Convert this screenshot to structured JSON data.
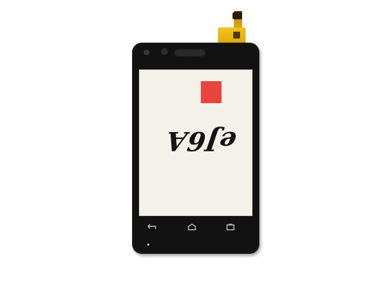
{
  "image": {
    "subject": "touchscreen-digitizer-panel",
    "handwritten_marking": "eJ6A",
    "icons": {
      "back": "back-arrow-icon",
      "home": "home-icon",
      "menu": "menu-icon"
    },
    "colors": {
      "bezel": "#121212",
      "screen_film": "#f4f1ea",
      "red_tab": "#e8433c",
      "flex_cable": "#f2c21d",
      "background": "#ffffff"
    }
  }
}
